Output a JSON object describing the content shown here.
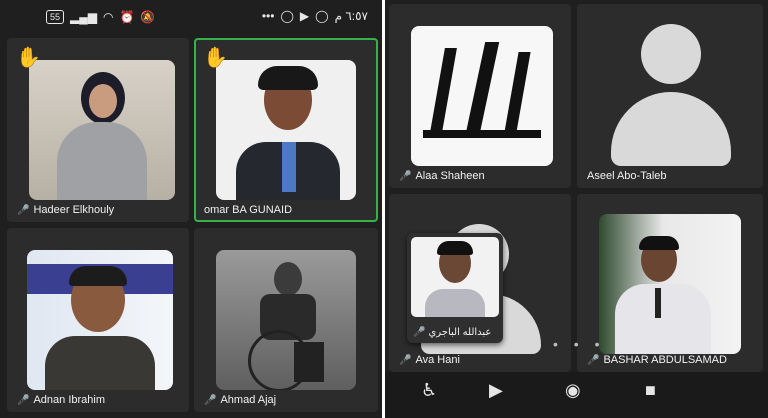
{
  "status_bar": {
    "battery": "55",
    "time": "٦:٥٧ م",
    "more": "•••"
  },
  "participants_left": [
    {
      "name": "Hadeer Elkhouly",
      "hand_raised": true,
      "muted": true,
      "speaking": false
    },
    {
      "name": "omar BA GUNAID",
      "hand_raised": true,
      "muted": false,
      "speaking": true
    },
    {
      "name": "Adnan Ibrahim",
      "hand_raised": false,
      "muted": true,
      "speaking": false
    },
    {
      "name": "Ahmad Ajaj",
      "hand_raised": false,
      "muted": true,
      "speaking": false
    }
  ],
  "participants_right": [
    {
      "name": "Alaa Shaheen",
      "muted": true
    },
    {
      "name": "Aseel Abo-Taleb",
      "muted": false
    },
    {
      "name": "Ava Hani",
      "muted": true
    },
    {
      "name": "BASHAR ABDULSAMAD",
      "muted": true
    }
  ],
  "floating_self_view": {
    "name": "عبدالله الباجري",
    "muted": true
  },
  "bottom_nav": {
    "accessibility": "accessibility-icon",
    "play": "play-icon",
    "record": "record-icon",
    "stop": "stop-icon"
  },
  "colors": {
    "active_speaker": "#35b34a",
    "muted_icon": "#e0443e"
  }
}
